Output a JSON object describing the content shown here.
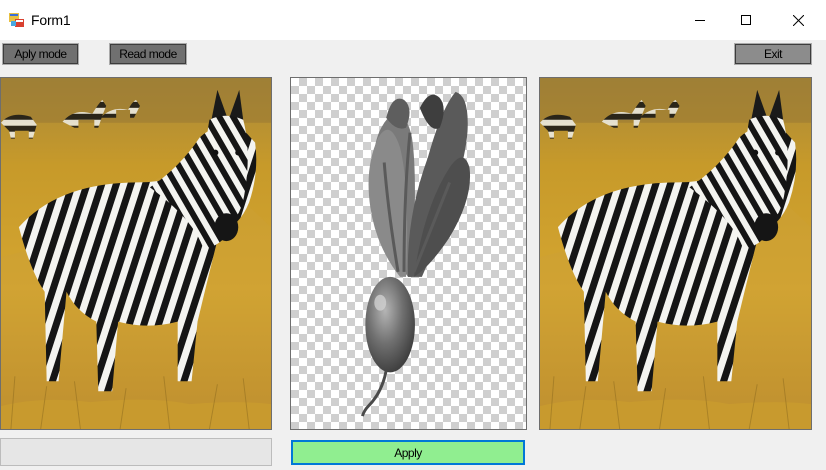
{
  "window": {
    "title": "Form1",
    "app_icon": "windows-forms-app-icon",
    "controls": [
      "minimize-icon",
      "maximize-icon",
      "close-icon"
    ]
  },
  "toolbar": {
    "aply_mode_label": "Aply mode",
    "read_mode_label": "Read mode",
    "exit_label": "Exit"
  },
  "images": {
    "left": "zebra-standing-in-golden-grass",
    "middle": "grayscale-beet-on-transparent-checkerboard",
    "right": "zebra-standing-in-golden-grass"
  },
  "progress": {
    "value": 0
  },
  "apply": {
    "label": "Apply"
  },
  "colors": {
    "apply_background": "#90ee90",
    "apply_border": "#0078d7",
    "button_background": "#707070",
    "form_background": "#f0f0f0"
  }
}
